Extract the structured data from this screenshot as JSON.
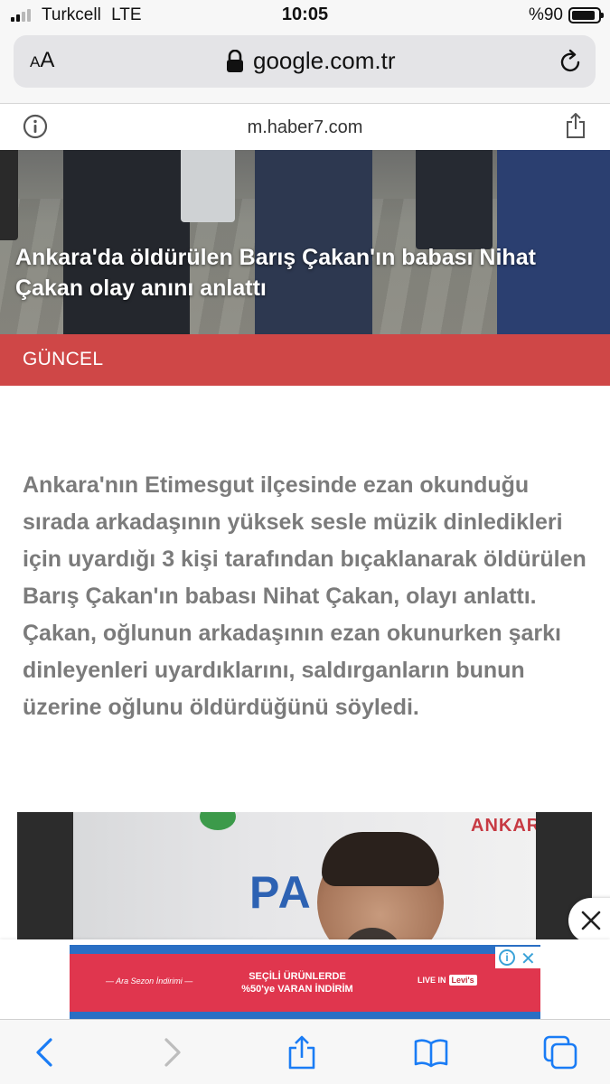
{
  "status_bar": {
    "carrier": "Turkcell",
    "network": "LTE",
    "time": "10:05",
    "battery_text": "%90",
    "battery_level": 0.9
  },
  "browser": {
    "text_size_label_small": "A",
    "text_size_label_large": "A",
    "url": "google.com.tr",
    "site_domain": "m.haber7.com"
  },
  "article": {
    "headline": "Ankara'da öldürülen Barış Çakan'ın babası Nihat Çakan olay anını anlattı",
    "category": "GÜNCEL",
    "summary": "Ankara'nın Etimesgut ilçesinde ezan okunduğu sırada arkadaşının yüksek sesle müzik dinledikleri için uyardığı 3 kişi tarafından bıçaklanarak öldürülen Barış Çakan'ın babası Nihat Çakan, olayı anlattı. Çakan, oğlunun arkadaşının ezan okunurken şarkı dinleyenleri uyardıklarını, saldırganların bunun üzerine oğlunu öldürdüğünü söyledi."
  },
  "video": {
    "banner_small": "ANKARA",
    "banner_large": "PA OS"
  },
  "ad": {
    "left_text": "— Ara Sezon İndirimi —",
    "center_line1": "SEÇİLİ ÜRÜNLERDE",
    "center_line2": "%50'ye VARAN İNDİRİM",
    "brand_prefix": "LIVE IN",
    "brand_logo": "Levi's",
    "adchoices_i": "i",
    "adchoices_x": "✕"
  },
  "icons": {
    "lock": "lock-icon",
    "reload": "reload-icon",
    "info": "info-icon",
    "share": "share-icon",
    "back": "back-chevron-icon",
    "forward": "forward-chevron-icon",
    "bookmarks": "bookmarks-icon",
    "tabs": "tabs-icon",
    "close": "close-icon"
  },
  "colors": {
    "category_strip": "#cf4747",
    "ios_blue": "#1a7cf5",
    "summary_text": "#7b7b7b"
  }
}
